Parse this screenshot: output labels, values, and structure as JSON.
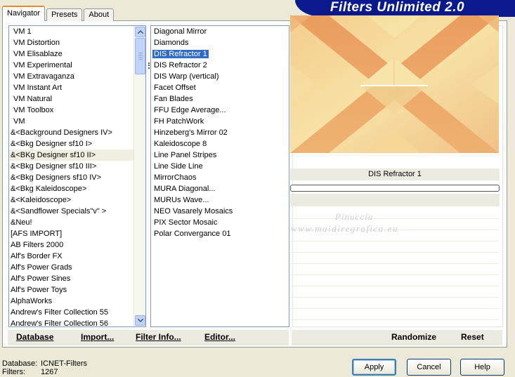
{
  "app_title": "Filters Unlimited 2.0",
  "tabs": [
    "Navigator",
    "Presets",
    "About"
  ],
  "categories": [
    "VM 1",
    "VM Distortion",
    "VM Elisablaze",
    "VM Experimental",
    "VM Extravaganza",
    "VM Instant Art",
    "VM Natural",
    "VM Toolbox",
    "VM",
    "&<Background Designers IV>",
    "&<Bkg Designer sf10 I>",
    "&<BKg Designer sf10 II>",
    "&<Bkg Designer sf10 III>",
    "&<Bkg Designers sf10 IV>",
    "&<Bkg Kaleidoscope>",
    "&<Kaleidoscope>",
    "&<Sandflower Specials\"v\" >",
    "&Neu!",
    "[AFS IMPORT]",
    "AB Filters 2000",
    "Alf's Border FX",
    "Alf's Power Grads",
    "Alf's Power Sines",
    "Alf's Power Toys",
    "AlphaWorks",
    "Andrew's Filter Collection 55",
    "Andrew's Filter Collection 56"
  ],
  "selected_category": "&<BKg Designer sf10 II>",
  "filters": [
    "Diagonal Mirror",
    "Diamonds",
    "DIS Refractor 1",
    "DIS Refractor 2",
    "DIS Warp (vertical)",
    "Facet Offset",
    "Fan Blades",
    "FFU Edge Average...",
    "FH PatchWork",
    "Hinzeberg's Mirror 02",
    "Kaleidoscope 8",
    "Line Panel Stripes",
    "Line Side Line",
    "MirrorChaos",
    "MURA Diagonal...",
    "MURUs Wave...",
    "NEO Vasarely Mosaics",
    "PIX Sector Mosaic",
    "Polar Convergance 01"
  ],
  "selected_filter": "DIS Refractor 1",
  "preview": {
    "filter_name": "DIS Refractor 1",
    "progress": 0,
    "colors": {
      "orange": "#e8a064",
      "peach": "#f2c48a",
      "cream": "#f6e0a0"
    }
  },
  "watermark": {
    "line1": "Pinuccia",
    "line2": "www.maidiregrafica.eu"
  },
  "left_bar": {
    "database": "Database",
    "import": "Import...",
    "filter_info": "Filter Info...",
    "editor": "Editor..."
  },
  "right_bar": {
    "randomize": "Randomize",
    "reset": "Reset"
  },
  "status": {
    "database_label": "Database:",
    "database_value": "ICNET-Filters",
    "filters_label": "Filters:",
    "filters_value": "1267"
  },
  "buttons": {
    "apply": "Apply",
    "cancel": "Cancel",
    "help": "Help"
  },
  "colors": {
    "banner": "#0a1a8c",
    "selection": "#316ac5",
    "tab_accent": "#e68b2c"
  }
}
